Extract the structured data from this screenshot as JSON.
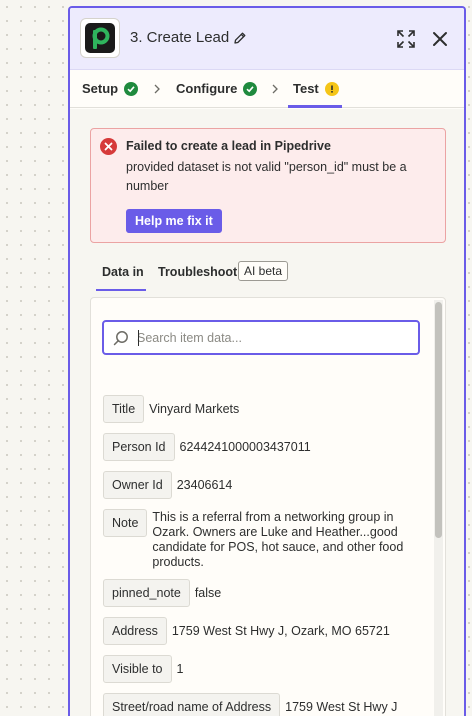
{
  "header": {
    "app_icon": "pipedrive-logo-icon",
    "title": "3. Create Lead",
    "edit_icon": "pencil-icon",
    "expand_icon": "expand-icon",
    "close_icon": "close-icon"
  },
  "steps": [
    {
      "label": "Setup",
      "status": "complete"
    },
    {
      "label": "Configure",
      "status": "complete"
    },
    {
      "label": "Test",
      "status": "warning"
    }
  ],
  "error": {
    "title": "Failed to create a lead in Pipedrive",
    "message": "provided dataset is not valid \"person_id\" must be a number",
    "button": "Help me fix it"
  },
  "tabs": {
    "data_in": "Data in",
    "troubleshoot": "Troubleshoot",
    "badge": "AI beta"
  },
  "search": {
    "placeholder": "Search item data...",
    "value": ""
  },
  "fields": [
    {
      "key": "Title",
      "value": "Vinyard Markets"
    },
    {
      "key": "Person Id",
      "value": "6244241000003437011"
    },
    {
      "key": "Owner Id",
      "value": "23406614"
    },
    {
      "key": "Note",
      "value": "This is a referral from a networking group in Ozark.  Owners are Luke and Heather...good candidate for POS, hot sauce, and other food products."
    },
    {
      "key": "pinned_note",
      "value": "false"
    },
    {
      "key": "Address",
      "value": "1759 West St Hwy J, Ozark, MO 65721"
    },
    {
      "key": "Visible to",
      "value": "1"
    },
    {
      "key": "Street/road name of Address",
      "value": "1759 West St Hwy J"
    }
  ],
  "colors": {
    "accent": "#6a5ce8",
    "success": "#1f8a3e",
    "warning": "#f5c518",
    "error": "#d63a3a"
  }
}
